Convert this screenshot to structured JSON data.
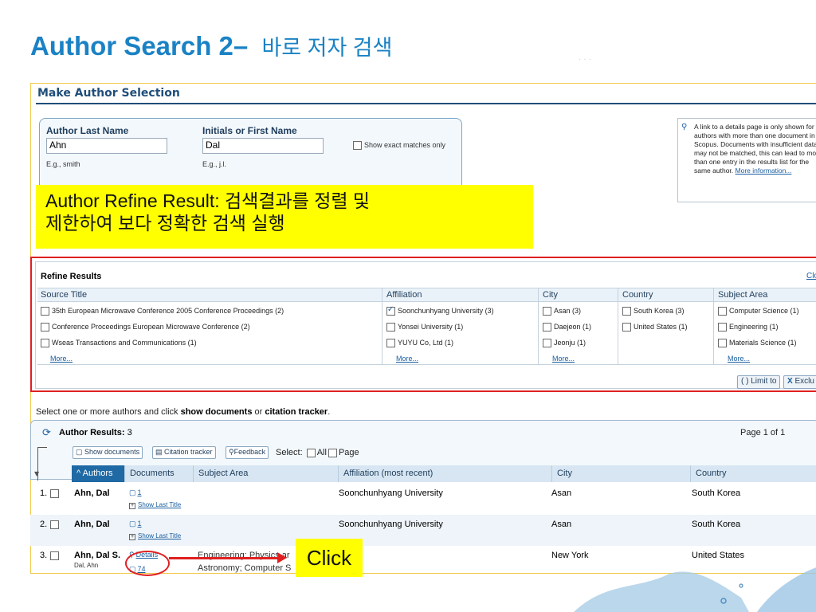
{
  "slide": {
    "title_main": "Author Search 2",
    "title_dash": "– ",
    "title_sub": "바로 저자 검색"
  },
  "panel": {
    "heading": "Make Author Selection"
  },
  "search": {
    "last_name_label": "Author Last Name",
    "last_name_value": "Ahn",
    "last_name_hint": "E.g., smith",
    "first_name_label": "Initials or First Name",
    "first_name_value": "Dal",
    "first_name_hint": "E.g., j.l.",
    "exact_label": "Show exact matches only"
  },
  "info": {
    "text": "A link to a details page is only shown for authors with more than one document in Scopus. Documents with insufficient data may not be matched, this can lead to more than one entry in the results list for the same author.",
    "link": "More information..."
  },
  "callout": {
    "line1": "Author Refine Result: 검색결과를 정렬 및",
    "line2": "제한하여 보다 정확한 검색 실행"
  },
  "refine": {
    "title": "Refine Results",
    "close": "Clo",
    "columns": {
      "source": "Source Title",
      "affiliation": "Affiliation",
      "city": "City",
      "country": "Country",
      "subject": "Subject Area"
    },
    "source_items": [
      {
        "label": "35th European Microwave Conference 2005 Conference Proceedings (2)",
        "checked": false
      },
      {
        "label": "Conference Proceedings European Microwave Conference (2)",
        "checked": false
      },
      {
        "label": "Wseas Transactions and Communications (1)",
        "checked": false
      }
    ],
    "affiliation_items": [
      {
        "label": "Soonchunhyang University (3)",
        "checked": true
      },
      {
        "label": "Yonsei University (1)",
        "checked": false
      },
      {
        "label": "YUYU Co, Ltd (1)",
        "checked": false
      }
    ],
    "city_items": [
      {
        "label": "Asan (3)",
        "checked": false
      },
      {
        "label": "Daejeon (1)",
        "checked": false
      },
      {
        "label": "Jeonju (1)",
        "checked": false
      }
    ],
    "country_items": [
      {
        "label": "South Korea (3)",
        "checked": false
      },
      {
        "label": "United States (1)",
        "checked": false
      }
    ],
    "subject_items": [
      {
        "label": "Computer Science (1)",
        "checked": false
      },
      {
        "label": "Engineering (1)",
        "checked": false
      },
      {
        "label": "Materials Science (1)",
        "checked": false
      }
    ],
    "more": "More...",
    "limit_btn": "Limit to",
    "exclude_btn": "Exclu"
  },
  "instruction": {
    "pre": "Select one or more authors and click ",
    "b1": "show documents",
    "mid": " or ",
    "b2": "citation tracker",
    "post": "."
  },
  "results": {
    "title_label": "Author Results:",
    "count": "3",
    "page": "Page  1 of 1",
    "btn_show_docs": "Show documents",
    "btn_citation": "Citation tracker",
    "btn_feedback": "Feedback",
    "select_label": "Select:",
    "all_label": "All",
    "page_label": "Page",
    "headers": {
      "authors": "^ Authors",
      "documents": "Documents",
      "subject": "Subject Area",
      "affiliation": "Affiliation (most recent)",
      "city": "City",
      "country": "Country"
    },
    "rows": [
      {
        "num": "1.",
        "author": "Ahn, Dal",
        "alias": "",
        "docs": "1",
        "show_last": "Show Last Title",
        "subject": "",
        "subject2": "",
        "affiliation": "Soonchunhyang University",
        "city": "Asan",
        "country": "South Korea"
      },
      {
        "num": "2.",
        "author": "Ahn, Dal",
        "alias": "",
        "docs": "1",
        "show_last": "Show Last Title",
        "subject": "",
        "subject2": "",
        "affiliation": "Soonchunhyang University",
        "city": "Asan",
        "country": "South Korea"
      },
      {
        "num": "3.",
        "author": "Ahn, Dal S.",
        "alias": "Dal, Ahn",
        "details": "Details",
        "docs": "74",
        "show_last": "",
        "subject": "Engineering; Physics ar",
        "subject2": "Astronomy; Computer S",
        "affiliation": "",
        "city": "New York",
        "country": "United States"
      }
    ]
  },
  "annotation": {
    "click_label": "Click"
  },
  "colors": {
    "title_blue": "#1a82c4",
    "highlight_yellow": "#ffff00",
    "annotation_red": "#e02020",
    "header_active": "#1f6aa5"
  }
}
